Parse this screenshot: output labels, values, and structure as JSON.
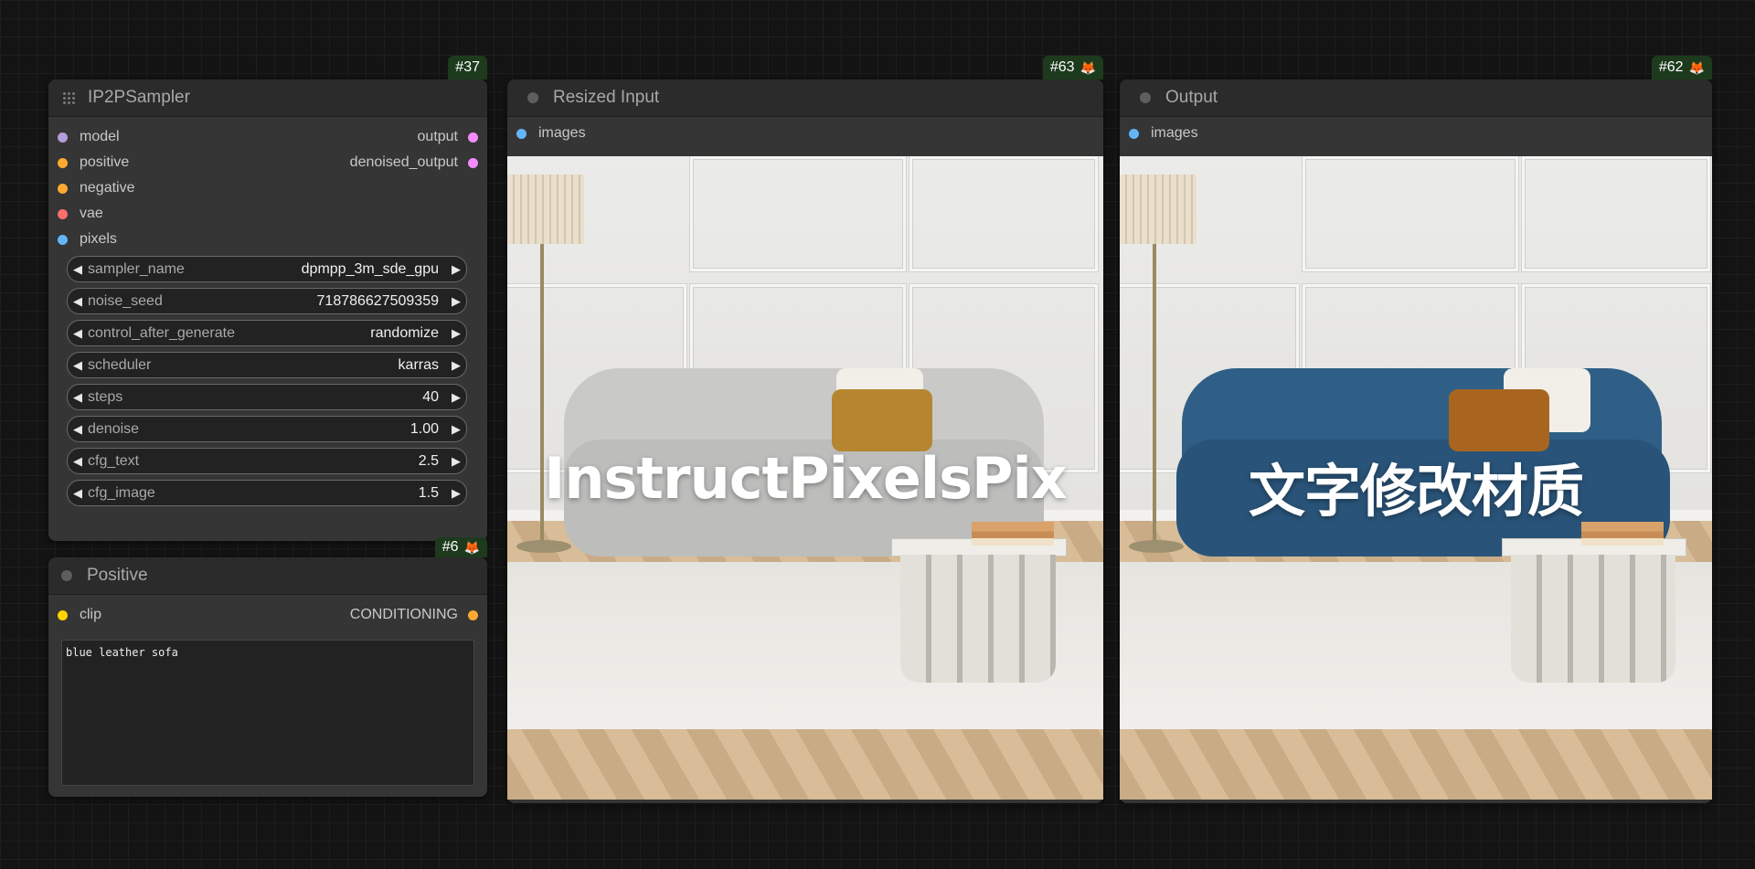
{
  "nodes": {
    "sampler": {
      "id": "#37",
      "title": "IP2PSampler",
      "inputs": [
        {
          "label": "model",
          "color": "#b39ddb"
        },
        {
          "label": "positive",
          "color": "#ffa931"
        },
        {
          "label": "negative",
          "color": "#ffa931"
        },
        {
          "label": "vae",
          "color": "#ff6e6e"
        },
        {
          "label": "pixels",
          "color": "#64b5f6"
        }
      ],
      "outputs": [
        {
          "label": "output",
          "color": "#f48cff"
        },
        {
          "label": "denoised_output",
          "color": "#f48cff"
        }
      ],
      "widgets": [
        {
          "label": "sampler_name",
          "value": "dpmpp_3m_sde_gpu"
        },
        {
          "label": "noise_seed",
          "value": "718786627509359"
        },
        {
          "label": "control_after_generate",
          "value": "randomize"
        },
        {
          "label": "scheduler",
          "value": "karras"
        },
        {
          "label": "steps",
          "value": "40"
        },
        {
          "label": "denoise",
          "value": "1.00"
        },
        {
          "label": "cfg_text",
          "value": "2.5"
        },
        {
          "label": "cfg_image",
          "value": "1.5"
        }
      ]
    },
    "positive": {
      "id": "#6",
      "title": "Positive",
      "input": {
        "label": "clip",
        "color": "#ffd500"
      },
      "output": {
        "label": "CONDITIONING",
        "color": "#ffa931"
      },
      "text": "blue leather sofa"
    },
    "resized_input": {
      "id": "#63",
      "title": "Resized Input",
      "input": {
        "label": "images",
        "color": "#64b5f6"
      },
      "image_caption": "InstructPixelsPix"
    },
    "output": {
      "id": "#62",
      "title": "Output",
      "input": {
        "label": "images",
        "color": "#64b5f6"
      },
      "image_caption": "文字修改材质"
    }
  },
  "colors": {
    "canvas": "#141414",
    "node_body": "#353535",
    "node_title": "#2b2b2b",
    "badge": "#1d3a1d",
    "sofa_input": "#c9c9c7",
    "sofa_output": "#2f5f86"
  },
  "icons": {
    "badge_icon": "fox-icon",
    "grip": "grip-icon"
  }
}
